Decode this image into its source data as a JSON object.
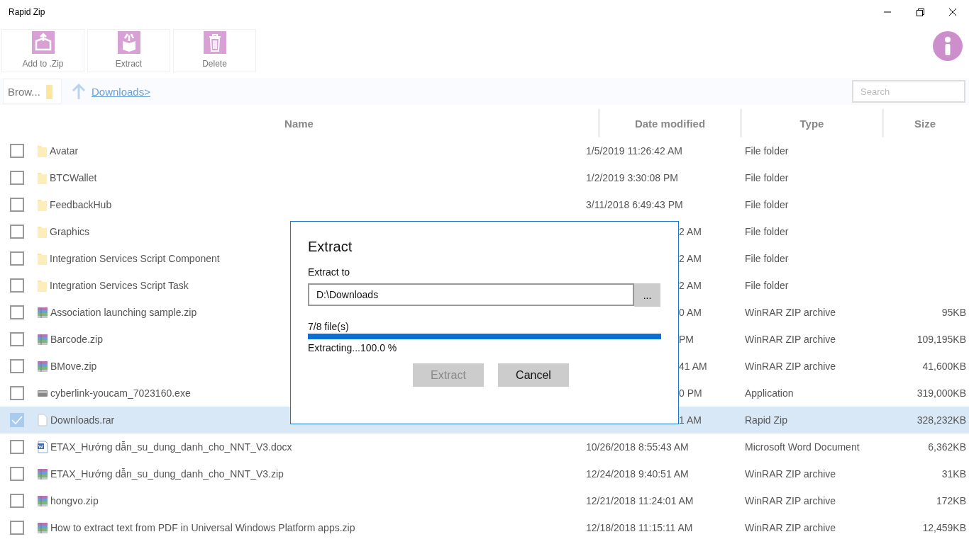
{
  "window": {
    "title": "Rapid Zip"
  },
  "toolbar": [
    {
      "label": "Add to .Zip",
      "kind": "add"
    },
    {
      "label": "Extract",
      "kind": "extract"
    },
    {
      "label": "Delete",
      "kind": "delete"
    }
  ],
  "pathbar": {
    "browse": "Brow...",
    "path": "Downloads>",
    "search_placeholder": "Search"
  },
  "table": {
    "columns": [
      "Name",
      "Date modified",
      "Type",
      "Size"
    ],
    "rows": [
      {
        "name": "Avatar",
        "kind": "folder",
        "date": "1/5/2019 11:26:42 AM",
        "type": "File folder",
        "checked": false,
        "selected": false
      },
      {
        "name": "BTCWallet",
        "kind": "folder",
        "date": "1/2/2019 3:30:08 PM",
        "type": "File folder",
        "checked": false,
        "selected": false
      },
      {
        "name": "FeedbackHub",
        "kind": "folder",
        "date": "3/11/2018 6:49:43 PM",
        "type": "File folder",
        "checked": false,
        "selected": false
      },
      {
        "name": "Graphics",
        "kind": "folder",
        "date": "2 AM",
        "type": "File folder",
        "checked": false,
        "selected": false
      },
      {
        "name": "Integration Services Script Component",
        "kind": "folder",
        "date": "2 AM",
        "type": "File folder",
        "checked": false,
        "selected": false
      },
      {
        "name": "Integration Services Script Task",
        "kind": "folder",
        "date": "2 AM",
        "type": "File folder",
        "checked": false,
        "selected": false
      },
      {
        "name": "Association launching sample.zip",
        "kind": "zip",
        "date": "0 AM",
        "type": "WinRAR ZIP archive",
        "size": "95KB",
        "checked": false,
        "selected": false
      },
      {
        "name": "Barcode.zip",
        "kind": "zip",
        "date": "PM",
        "type": "WinRAR ZIP archive",
        "size": "109,195KB",
        "checked": false,
        "selected": false
      },
      {
        "name": "BMove.zip",
        "kind": "zip",
        "date": "41 AM",
        "type": "WinRAR ZIP archive",
        "size": "41,600KB",
        "checked": false,
        "selected": false
      },
      {
        "name": "cyberlink-youcam_7023160.exe",
        "kind": "exe",
        "date": "0 PM",
        "type": "Application",
        "size": "319,000KB",
        "checked": false,
        "selected": false
      },
      {
        "name": "Downloads.rar",
        "kind": "file",
        "date": "1 AM",
        "type": "Rapid Zip",
        "size": "328,232KB",
        "checked": true,
        "selected": true
      },
      {
        "name": "ETAX_Hướng dẫn_su_dung_danh_cho_NNT_V3.docx",
        "kind": "docx",
        "date": "10/26/2018 8:55:43 AM",
        "type": "Microsoft Word Document",
        "size": "6,362KB",
        "checked": false,
        "selected": false
      },
      {
        "name": "ETAX_Hướng dẫn_su_dung_danh_cho_NNT_V3.zip",
        "kind": "zip",
        "date": "12/24/2018 9:40:51 AM",
        "type": "WinRAR ZIP archive",
        "size": "31KB",
        "checked": false,
        "selected": false
      },
      {
        "name": "hongvo.zip",
        "kind": "zip",
        "date": "12/21/2018 11:24:01 AM",
        "type": "WinRAR ZIP archive",
        "size": "172KB",
        "checked": false,
        "selected": false
      },
      {
        "name": "How to extract text from PDF in Universal Windows Platform apps.zip",
        "kind": "zip",
        "date": "12/18/2018 11:15:11 AM",
        "type": "WinRAR ZIP archive",
        "size": "12,459KB",
        "checked": false,
        "selected": false
      }
    ]
  },
  "dialog": {
    "title": "Extract",
    "field_label": "Extract to",
    "value": "D:\\Downloads",
    "browse": "...",
    "count": "7/8 file(s)",
    "level": 1,
    "status": "Extracting...100.0 %",
    "buttons": [
      {
        "label": "Extract",
        "disabled": true
      },
      {
        "label": "Cancel",
        "disabled": false
      }
    ]
  }
}
